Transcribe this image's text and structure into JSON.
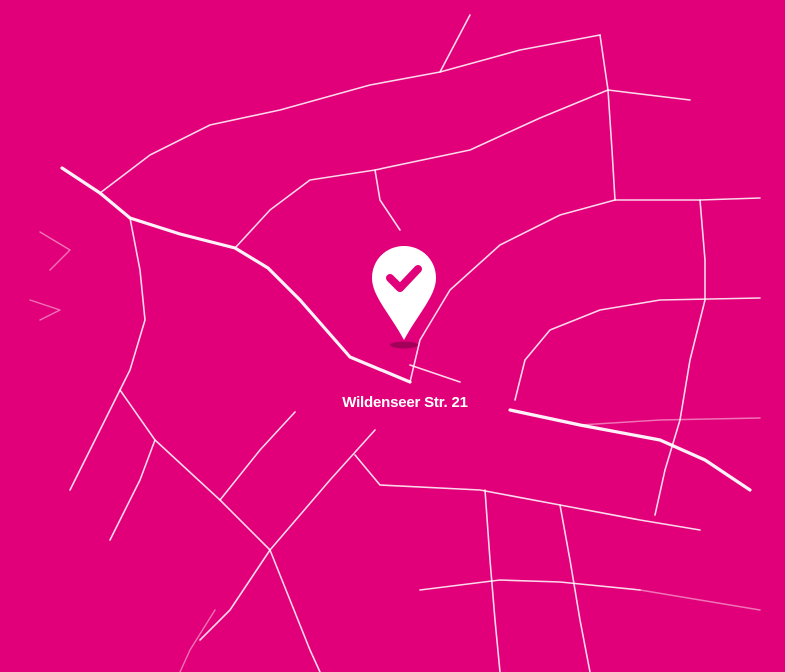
{
  "map": {
    "background_color": "#e2007a",
    "street_color": "#ffffff",
    "location": {
      "address": "Wildenseer Str. 21",
      "marker_icon": "location-pin-check-icon"
    }
  }
}
